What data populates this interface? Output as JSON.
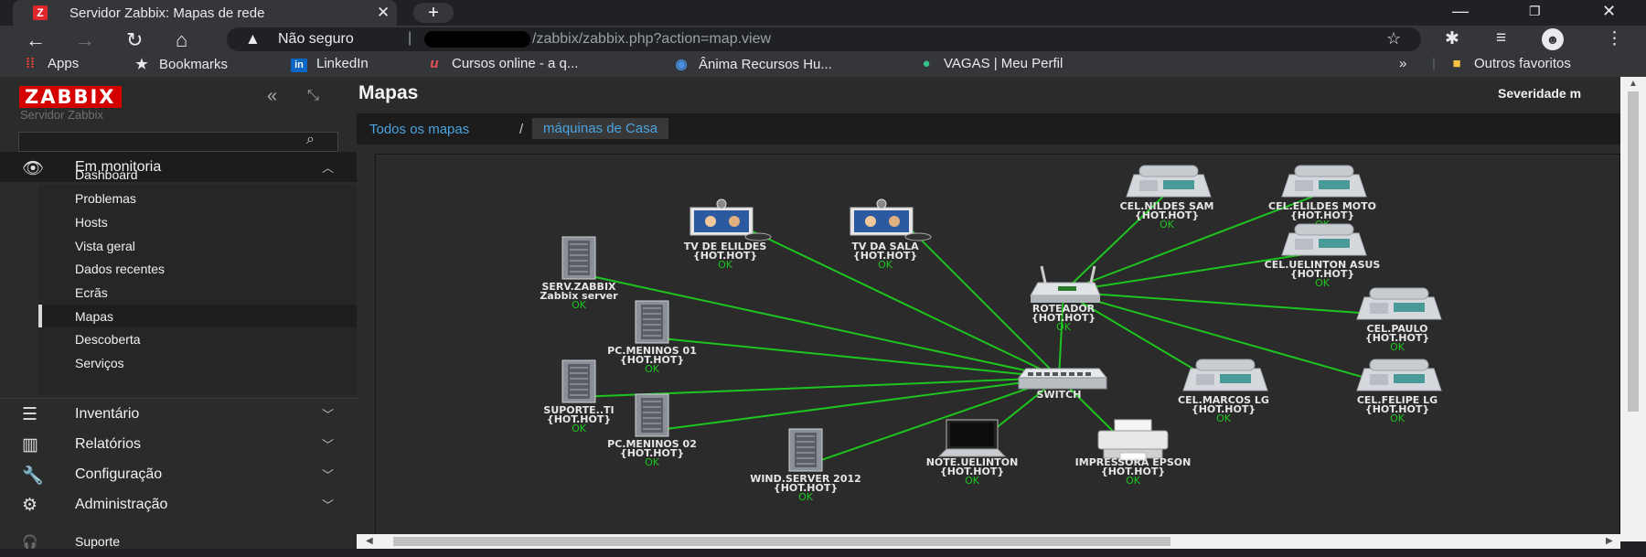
{
  "browser": {
    "tab_title": "Servidor Zabbix: Mapas de rede",
    "tab_favicon": "Z",
    "new_tab_icon": "plus-icon",
    "omnibox": {
      "security": "Não seguro",
      "url": "/zabbix/zabbix.php?action=map.view"
    },
    "bookmarks": [
      {
        "label": "Apps",
        "icon": "apps-grid-icon"
      },
      {
        "label": "Bookmarks",
        "icon": "star-icon"
      },
      {
        "label": "LinkedIn",
        "icon": "linkedin-icon"
      },
      {
        "label": "Cursos online - a q...",
        "icon": "udemy-icon"
      },
      {
        "label": "Ânima Recursos Hu...",
        "icon": "anima-icon"
      },
      {
        "label": "VAGAS | Meu Perfil",
        "icon": "vagas-icon"
      }
    ],
    "other_bookmarks": "Outros favoritos"
  },
  "sidebar": {
    "logo": "ZABBIX",
    "server_name": "Servidor Zabbix",
    "sections": [
      {
        "label": "Em monitoria",
        "icon": "eye-icon",
        "expanded": true
      },
      {
        "label": "Inventário",
        "icon": "list-icon",
        "expanded": false
      },
      {
        "label": "Relatórios",
        "icon": "bar-chart-icon",
        "expanded": false
      },
      {
        "label": "Configuração",
        "icon": "wrench-icon",
        "expanded": false
      },
      {
        "label": "Administração",
        "icon": "gear-icon",
        "expanded": false
      },
      {
        "label": "Suporte",
        "icon": "headset-icon"
      }
    ],
    "monitoring_items": [
      "Dashboard",
      "Problemas",
      "Hosts",
      "Vista geral",
      "Dados recentes",
      "Ecrãs",
      "Mapas",
      "Descoberta",
      "Serviços"
    ],
    "active_item": "Mapas"
  },
  "main": {
    "title": "Mapas",
    "severity_label": "Severidade m",
    "breadcrumbs": [
      "Todos os mapas",
      "máquinas de Casa"
    ]
  },
  "map": {
    "link_color": "#1ec41e",
    "ok_color": "#1ec41e",
    "nodes": [
      {
        "id": "serv",
        "type": "server",
        "name": "SERV.ZABBIX",
        "sub": "Zabbix server",
        "status": "OK"
      },
      {
        "id": "tv_elildes",
        "type": "tv",
        "name": "TV DE ELILDES",
        "sub": "{HOT.HOT}",
        "status": "OK"
      },
      {
        "id": "tv_sala",
        "type": "tv",
        "name": "TV DA SALA",
        "sub": "{HOT.HOT}",
        "status": "OK"
      },
      {
        "id": "cel_nildes",
        "type": "phone",
        "name": "CEL.NILDES SAM",
        "sub": "{HOT.HOT}",
        "status": "OK"
      },
      {
        "id": "cel_elildes",
        "type": "phone",
        "name": "CEL.ELILDES MOTO",
        "sub": "{HOT.HOT}",
        "status": "OK"
      },
      {
        "id": "cel_uelinton",
        "type": "phone",
        "name": "CEL.UELINTON ASUS",
        "sub": "{HOT.HOT}",
        "status": "OK"
      },
      {
        "id": "roteador",
        "type": "router",
        "name": "ROTEADOR",
        "sub": "{HOT.HOT}",
        "status": "OK"
      },
      {
        "id": "cel_paulo",
        "type": "phone",
        "name": "CEL.PAULO",
        "sub": "{HOT.HOT}",
        "status": "OK"
      },
      {
        "id": "pc01",
        "type": "server",
        "name": "PC.MENINOS 01",
        "sub": "{HOT.HOT}",
        "status": "OK"
      },
      {
        "id": "suporte",
        "type": "server",
        "name": "SUPORTE..TI",
        "sub": "{HOT.HOT}",
        "status": "OK"
      },
      {
        "id": "switch",
        "type": "switch",
        "name": "SWITCH",
        "sub": "",
        "status": ""
      },
      {
        "id": "cel_marcos",
        "type": "phone",
        "name": "CEL.MARCOS LG",
        "sub": "{HOT.HOT}",
        "status": "OK"
      },
      {
        "id": "cel_felipe",
        "type": "phone",
        "name": "CEL.FELIPE LG",
        "sub": "{HOT.HOT}",
        "status": "OK"
      },
      {
        "id": "pc02",
        "type": "server",
        "name": "PC.MENINOS 02",
        "sub": "{HOT.HOT}",
        "status": "OK"
      },
      {
        "id": "wind",
        "type": "server",
        "name": "WIND.SERVER 2012",
        "sub": "{HOT.HOT}",
        "status": "OK"
      },
      {
        "id": "note",
        "type": "laptop",
        "name": "NOTE.UELINTON",
        "sub": "{HOT.HOT}",
        "status": "OK"
      },
      {
        "id": "impressora",
        "type": "printer",
        "name": "IMPRESSORA EPSON",
        "sub": "{HOT.HOT}",
        "status": "OK"
      }
    ],
    "links": [
      [
        "switch",
        "serv"
      ],
      [
        "switch",
        "tv_elildes"
      ],
      [
        "switch",
        "tv_sala"
      ],
      [
        "switch",
        "pc01"
      ],
      [
        "switch",
        "suporte"
      ],
      [
        "switch",
        "pc02"
      ],
      [
        "switch",
        "wind"
      ],
      [
        "switch",
        "note"
      ],
      [
        "switch",
        "impressora"
      ],
      [
        "switch",
        "roteador"
      ],
      [
        "roteador",
        "cel_nildes"
      ],
      [
        "roteador",
        "cel_elildes"
      ],
      [
        "roteador",
        "cel_uelinton"
      ],
      [
        "roteador",
        "cel_paulo"
      ],
      [
        "roteador",
        "cel_marcos"
      ],
      [
        "roteador",
        "cel_felipe"
      ]
    ]
  }
}
